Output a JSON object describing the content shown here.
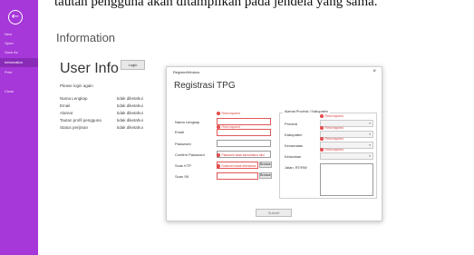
{
  "doc_heading": "tautan pengguna akan ditampilkan pada jendela yang sama.",
  "sidebar": {
    "back_icon": "back-arrow-icon",
    "items": [
      {
        "label": "New"
      },
      {
        "label": "Open"
      },
      {
        "label": "Save As"
      },
      {
        "label": "Information"
      },
      {
        "label": "Print"
      },
      {
        "label": "Close"
      }
    ],
    "active": "Information",
    "accent": "#a637d8"
  },
  "main": {
    "title": "Information",
    "user_info_title": "User Info",
    "login_button": "Login",
    "please_login": "Please login again",
    "rows": [
      {
        "key": "Nama Lengkap",
        "value": "tidak diketahui"
      },
      {
        "key": "Email",
        "value": "tidak diketahui"
      },
      {
        "key": "Alamat",
        "value": "tidak diketahui"
      },
      {
        "key": "Tautan profil pengguna",
        "value": "tidak diketahui"
      },
      {
        "key": "Status perijinan",
        "value": "tidak diketahui"
      }
    ]
  },
  "window": {
    "title": "RegisterWindow",
    "close": "×",
    "heading": "Registrasi TPG",
    "fields": [
      {
        "label": "Nama Lengkap",
        "error": "Field required"
      },
      {
        "label": "Email",
        "error": "Field required"
      },
      {
        "label": "Password",
        "error": ""
      },
      {
        "label": "Confirm Password",
        "error": "Password tidak sama/harus diisi"
      },
      {
        "label": "Scan KTP",
        "error": "Dokumen tidak ditemukan",
        "browse": "Browse"
      },
      {
        "label": "Scan SK",
        "error": "Dokumen tidak ditemukan",
        "browse": "Browse"
      }
    ],
    "address_group": {
      "title": "Alamat Provinsi / Kabupaten",
      "fields": [
        {
          "label": "Provinsi",
          "error": "Field required"
        },
        {
          "label": "Kabupaten",
          "error": "Field required"
        },
        {
          "label": "Kecamatan",
          "error": "Field required"
        },
        {
          "label": "Kelurahan",
          "error": "Field required"
        },
        {
          "label": "Jalan, RT/RW",
          "error": ""
        }
      ]
    },
    "submit": "Submit",
    "error_color": "#d83b3b"
  }
}
